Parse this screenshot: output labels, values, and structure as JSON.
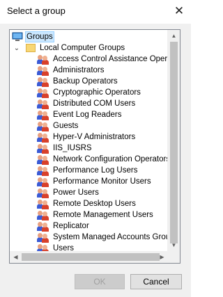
{
  "window": {
    "title": "Select a group",
    "close_glyph": "✕"
  },
  "tree": {
    "root": {
      "label": "Groups",
      "icon": "computer-icon"
    },
    "folder": {
      "label": "Local Computer Groups",
      "icon": "folder-icon",
      "expander": "⌄"
    },
    "groups": [
      "Access Control Assistance Operators",
      "Administrators",
      "Backup Operators",
      "Cryptographic Operators",
      "Distributed COM Users",
      "Event Log Readers",
      "Guests",
      "Hyper-V Administrators",
      "IIS_IUSRS",
      "Network Configuration Operators",
      "Performance Log Users",
      "Performance Monitor Users",
      "Power Users",
      "Remote Desktop Users",
      "Remote Management Users",
      "Replicator",
      "System Managed Accounts Group",
      "Users"
    ],
    "group_icon": "users-group-icon"
  },
  "scrollbars": {
    "up": "▲",
    "down": "▼",
    "left": "◀",
    "right": "▶"
  },
  "buttons": {
    "ok": "OK",
    "cancel": "Cancel"
  }
}
